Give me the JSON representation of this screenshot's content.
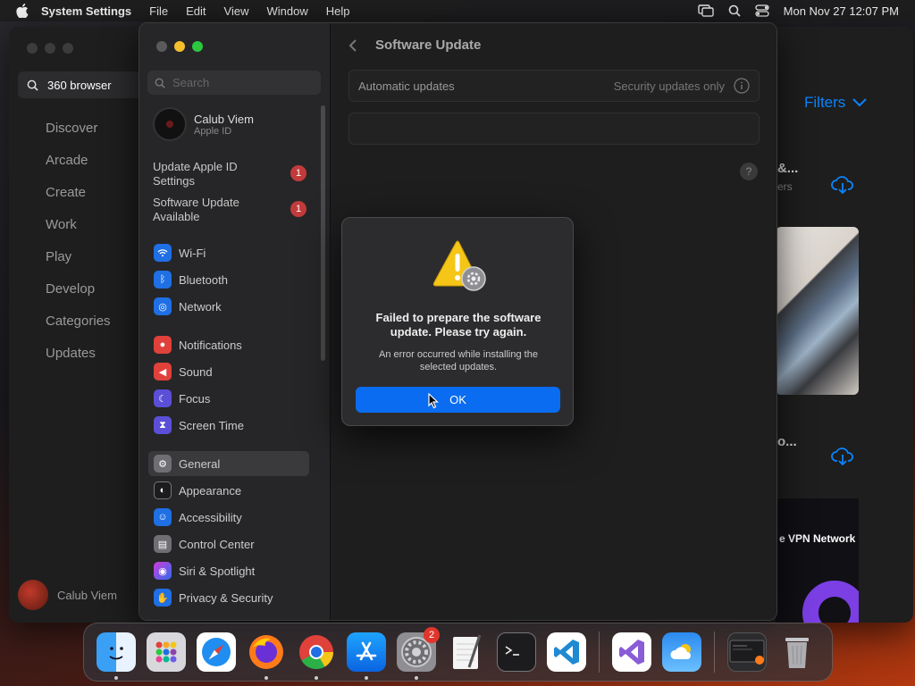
{
  "menubar": {
    "app_name": "System Settings",
    "menus": [
      "File",
      "Edit",
      "View",
      "Window",
      "Help"
    ],
    "clock": "Mon Nov 27  12:07 PM"
  },
  "store": {
    "search_value": "360 browser",
    "nav": [
      "Discover",
      "Arcade",
      "Create",
      "Work",
      "Play",
      "Develop",
      "Categories",
      "Updates"
    ],
    "user_name": "Calub Viem",
    "filters_label": "Filters",
    "card1_title": "&...",
    "card1_sub": "ers",
    "card2_title": "o...",
    "vpn_text": "e VPN Network"
  },
  "settings": {
    "search_placeholder": "Search",
    "account": {
      "name": "Calub Viem",
      "subtitle": "Apple ID"
    },
    "notices": [
      {
        "label": "Update Apple ID Settings",
        "badge": "1"
      },
      {
        "label": "Software Update Available",
        "badge": "1"
      }
    ],
    "items": [
      {
        "label": "Wi-Fi",
        "icon": "wifi-icon"
      },
      {
        "label": "Bluetooth",
        "icon": "bluetooth-icon"
      },
      {
        "label": "Network",
        "icon": "globe-icon"
      },
      {
        "label": "Notifications",
        "icon": "bell-icon"
      },
      {
        "label": "Sound",
        "icon": "speaker-icon"
      },
      {
        "label": "Focus",
        "icon": "moon-icon"
      },
      {
        "label": "Screen Time",
        "icon": "hourglass-icon"
      },
      {
        "label": "General",
        "icon": "gear-icon"
      },
      {
        "label": "Appearance",
        "icon": "appearance-icon"
      },
      {
        "label": "Accessibility",
        "icon": "accessibility-icon"
      },
      {
        "label": "Control Center",
        "icon": "control-center-icon"
      },
      {
        "label": "Siri & Spotlight",
        "icon": "siri-icon"
      },
      {
        "label": "Privacy & Security",
        "icon": "hand-icon"
      }
    ],
    "selected": "General",
    "content_title": "Software Update",
    "auto_updates_label": "Automatic updates",
    "auto_updates_value": "Security updates only",
    "help_label": "?"
  },
  "dialog": {
    "title": "Failed to prepare the software update. Please try again.",
    "message": "An error occurred while installing the selected updates.",
    "ok_label": "OK"
  },
  "dock": {
    "items": [
      "Finder",
      "Launchpad",
      "Safari",
      "Firefox",
      "Chrome",
      "App Store",
      "System Settings",
      "TextEdit",
      "Terminal",
      "Visual Studio Code",
      "Visual Studio",
      "Weather",
      "Downloads",
      "Trash"
    ],
    "system_settings_badge": "2"
  },
  "colors": {
    "accent": "#0a84ff",
    "button": "#0a6cf0",
    "badge": "#c23b3b"
  }
}
